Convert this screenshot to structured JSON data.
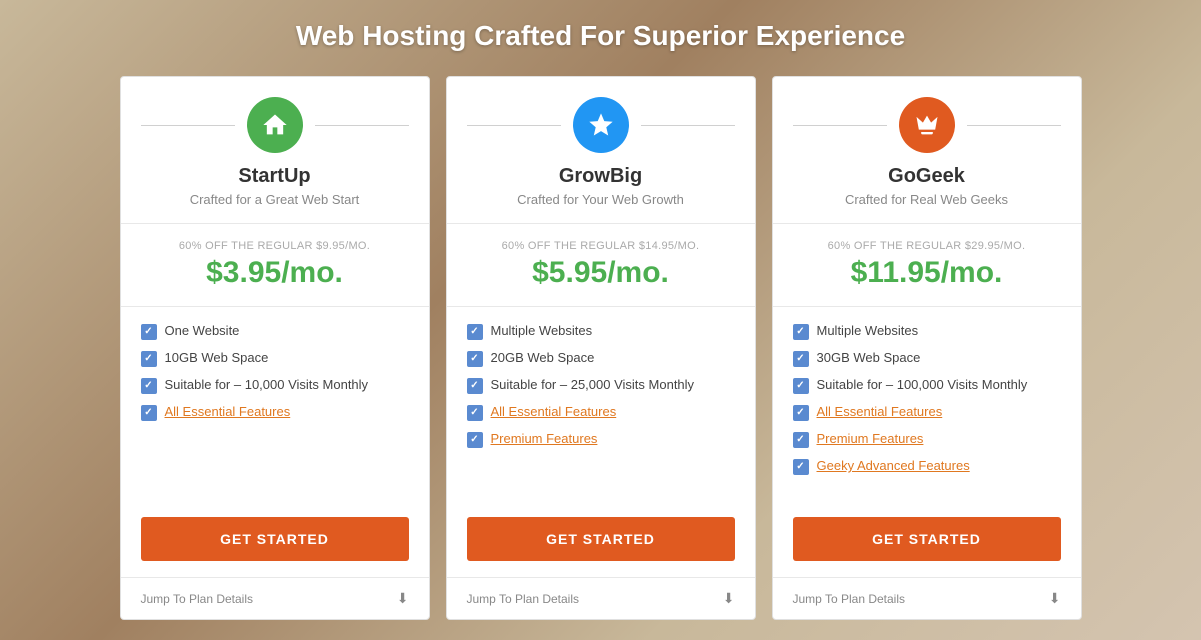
{
  "page": {
    "title": "Web Hosting Crafted For Superior Experience"
  },
  "plans": [
    {
      "id": "startup",
      "icon_type": "green",
      "icon_name": "home-icon",
      "name": "StartUp",
      "tagline": "Crafted for a Great Web Start",
      "discount_text": "60% OFF THE REGULAR $9.95/MO.",
      "price": "$3.95/mo.",
      "features": [
        {
          "text": "One Website",
          "is_link": false
        },
        {
          "text": "10GB Web Space",
          "is_link": false
        },
        {
          "text": "Suitable for – 10,000 Visits Monthly",
          "is_link": false
        },
        {
          "text": "All Essential Features",
          "is_link": true
        }
      ],
      "cta_label": "GET STARTED",
      "jump_label": "Jump To Plan Details"
    },
    {
      "id": "growbig",
      "icon_type": "blue",
      "icon_name": "star-icon",
      "name": "GrowBig",
      "tagline": "Crafted for Your Web Growth",
      "discount_text": "60% OFF THE REGULAR $14.95/MO.",
      "price": "$5.95/mo.",
      "features": [
        {
          "text": "Multiple Websites",
          "is_link": false
        },
        {
          "text": "20GB Web Space",
          "is_link": false
        },
        {
          "text": "Suitable for – 25,000 Visits Monthly",
          "is_link": false
        },
        {
          "text": "All Essential Features",
          "is_link": true
        },
        {
          "text": "Premium Features",
          "is_link": true
        }
      ],
      "cta_label": "GET STARTED",
      "jump_label": "Jump To Plan Details"
    },
    {
      "id": "gogeek",
      "icon_type": "orange",
      "icon_name": "crown-icon",
      "name": "GoGeek",
      "tagline": "Crafted for Real Web Geeks",
      "discount_text": "60% OFF THE REGULAR $29.95/MO.",
      "price": "$11.95/mo.",
      "features": [
        {
          "text": "Multiple Websites",
          "is_link": false
        },
        {
          "text": "30GB Web Space",
          "is_link": false
        },
        {
          "text": "Suitable for – 100,000 Visits Monthly",
          "is_link": false
        },
        {
          "text": "All Essential Features",
          "is_link": true
        },
        {
          "text": "Premium Features",
          "is_link": true
        },
        {
          "text": "Geeky Advanced Features",
          "is_link": true
        }
      ],
      "cta_label": "GET STARTED",
      "jump_label": "Jump To Plan Details"
    }
  ]
}
